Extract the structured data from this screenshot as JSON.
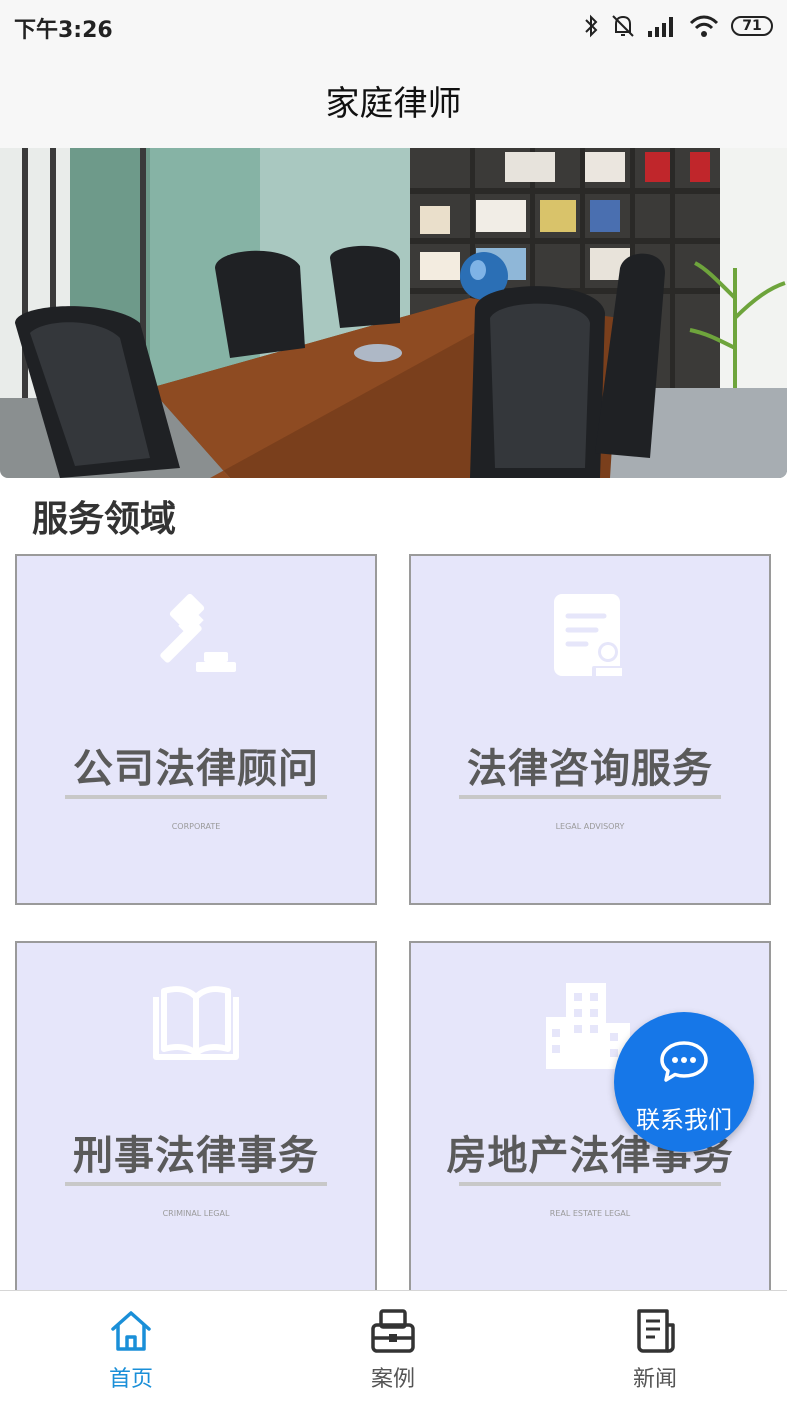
{
  "status_bar": {
    "time": "下午3:26",
    "battery": "71",
    "icons": [
      "bluetooth-icon",
      "mute-icon",
      "signal-icon",
      "wifi-icon",
      "battery-icon"
    ]
  },
  "header": {
    "title": "家庭律师"
  },
  "section": {
    "title": "服务领域"
  },
  "services": [
    {
      "title": "公司法律顾问",
      "subtitle": "CORPORATE",
      "icon": "gavel-icon"
    },
    {
      "title": "法律咨询服务",
      "subtitle": "LEGAL ADVISORY",
      "icon": "document-stamp-icon"
    },
    {
      "title": "刑事法律事务",
      "subtitle": "CRIMINAL LEGAL",
      "icon": "book-icon"
    },
    {
      "title": "房地产法律事务",
      "subtitle": "REAL ESTATE LEGAL",
      "icon": "building-icon"
    }
  ],
  "contact": {
    "label": "联系我们",
    "icon": "chat-bubble-icon"
  },
  "tabs": [
    {
      "label": "首页",
      "icon": "home-icon",
      "active": true
    },
    {
      "label": "案例",
      "icon": "cases-icon",
      "active": false
    },
    {
      "label": "新闻",
      "icon": "news-icon",
      "active": false
    }
  ],
  "colors": {
    "accent": "#1a8fd8",
    "fab": "#1677e8",
    "card_bg": "#e6e6fa"
  }
}
